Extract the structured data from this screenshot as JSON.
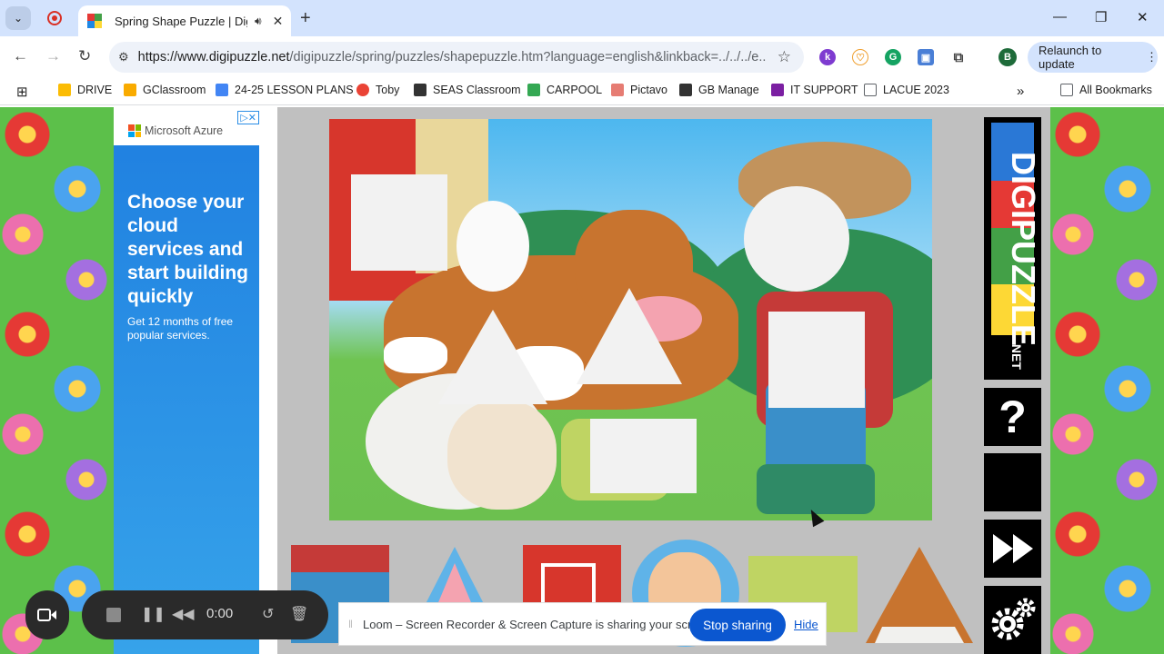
{
  "browser": {
    "tab_title": "Spring Shape Puzzle | Digip",
    "url_host": "https://www.digipuzzle.net",
    "url_path": "/digipuzzle/spring/puzzles/shapepuzzle.htm?language=english&linkback=../../../e...",
    "relaunch_label": "Relaunch to update",
    "profile_initial": "B",
    "ext_k": "k"
  },
  "bookmarks": [
    {
      "label": "DRIVE",
      "color": "#fbbc04"
    },
    {
      "label": "GClassroom",
      "color": "#f9ab00"
    },
    {
      "label": "24-25 LESSON PLANS",
      "color": "#4285f4"
    },
    {
      "label": "Toby",
      "color": "#ea4335"
    },
    {
      "label": "SEAS Classroom",
      "color": "#333333"
    },
    {
      "label": "CARPOOL",
      "color": "#34a853"
    },
    {
      "label": "Pictavo",
      "color": "#e67c73"
    },
    {
      "label": "GB Manage",
      "color": "#333333"
    },
    {
      "label": "IT SUPPORT",
      "color": "#7b1fa2"
    },
    {
      "label": "LACUE 2023",
      "color": "#5f6368"
    },
    {
      "label": "All Bookmarks",
      "color": "#5f6368"
    }
  ],
  "ad": {
    "brand": "Microsoft Azure",
    "headline": "Choose your cloud services and start building quickly",
    "sub": "Get 12 months of free popular services."
  },
  "game": {
    "logo_text": "DIGIPUZZLE",
    "logo_suffix": ".NET",
    "help_label": "?"
  },
  "loom": {
    "time": "0:00",
    "share_text": "Loom – Screen Recorder & Screen Capture is sharing your screen.",
    "stop_label": "Stop sharing",
    "hide_label": "Hide"
  },
  "colors": {
    "accent": "#0b57d0",
    "chrome_bg": "#d3e3fd"
  }
}
